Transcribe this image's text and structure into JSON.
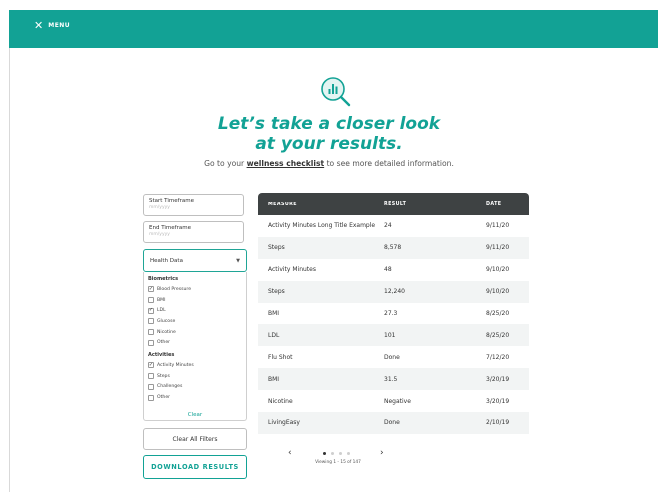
{
  "header": {
    "menu_label": "MENU",
    "menu_icon": "close-x-icon",
    "color": "#12a295"
  },
  "hero": {
    "icon": "chart-magnifier-icon",
    "headline_line1": "Let’s take a closer look",
    "headline_line2": "at your results.",
    "sub_prefix": "Go to your ",
    "sub_link": "wellness checklist",
    "sub_suffix": " to see more detailed information."
  },
  "filters": {
    "start": {
      "label": "Start Timeframe",
      "placeholder": "mm/yyyy"
    },
    "end": {
      "label": "End Timeframe",
      "placeholder": "mm/yyyy"
    },
    "dropdown_label": "Health Data",
    "groups": [
      {
        "title": "Biometrics",
        "options": [
          {
            "label": "Blood Pressure",
            "checked": true
          },
          {
            "label": "BMI",
            "checked": false
          },
          {
            "label": "LDL",
            "checked": true
          },
          {
            "label": "Glucose",
            "checked": false
          },
          {
            "label": "Nicotine",
            "checked": false
          },
          {
            "label": "Other",
            "checked": false
          }
        ]
      },
      {
        "title": "Activities",
        "options": [
          {
            "label": "Activity Minutes",
            "checked": true
          },
          {
            "label": "Steps",
            "checked": false
          },
          {
            "label": "Challenges",
            "checked": false
          },
          {
            "label": "Other",
            "checked": false
          }
        ]
      }
    ],
    "clear_label": "Clear",
    "clear_all_label": "Clear All Filters",
    "download_label": "DOWNLOAD RESULTS"
  },
  "table": {
    "headers": {
      "measure": "MEASURE",
      "result": "RESULT",
      "date": "DATE"
    },
    "rows": [
      {
        "measure": "Activity Minutes Long Title Example",
        "result": "24",
        "date": "9/11/20"
      },
      {
        "measure": "Steps",
        "result": "8,578",
        "date": "9/11/20"
      },
      {
        "measure": "Activity Minutes",
        "result": "48",
        "date": "9/10/20"
      },
      {
        "measure": "Steps",
        "result": "12,240",
        "date": "9/10/20"
      },
      {
        "measure": "BMI",
        "result": "27.3",
        "date": "8/25/20"
      },
      {
        "measure": "LDL",
        "result": "101",
        "date": "8/25/20"
      },
      {
        "measure": "Flu Shot",
        "result": "Done",
        "date": "7/12/20"
      },
      {
        "measure": "BMI",
        "result": "31.5",
        "date": "3/20/19"
      },
      {
        "measure": "Nicotine",
        "result": "Negative",
        "date": "3/20/19"
      },
      {
        "measure": "LivingEasy",
        "result": "Done",
        "date": "2/10/19"
      }
    ]
  },
  "pagination": {
    "prev": "‹",
    "next": "›",
    "pages": 4,
    "current": 1,
    "viewing": "Viewing 1 - 15 of 147"
  }
}
